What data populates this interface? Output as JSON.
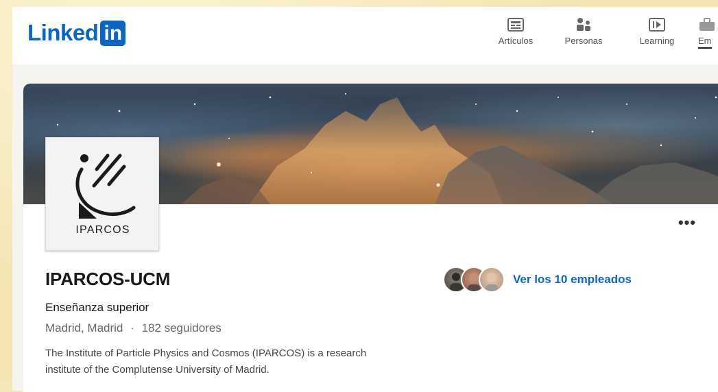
{
  "brand": {
    "word": "Linked",
    "badge": "in",
    "color": "#0a66c2"
  },
  "nav": {
    "items": [
      {
        "label": "Artículos",
        "icon": "articles-icon"
      },
      {
        "label": "Personas",
        "icon": "people-icon"
      },
      {
        "label": "Learning",
        "icon": "learning-icon"
      },
      {
        "label": "Em",
        "icon": "jobs-icon"
      }
    ]
  },
  "company": {
    "logo_text": "IPARCOS",
    "name": "IPARCOS-UCM",
    "industry": "Enseñanza superior",
    "location": "Madrid, Madrid",
    "separator": "·",
    "followers": "182 seguidores",
    "description": "The Institute of Particle Physics and Cosmos (IPARCOS) is a research institute of the Complutense University of Madrid."
  },
  "employees": {
    "link_text": "Ver los 10 empleados"
  },
  "more": {
    "label": "•••"
  }
}
